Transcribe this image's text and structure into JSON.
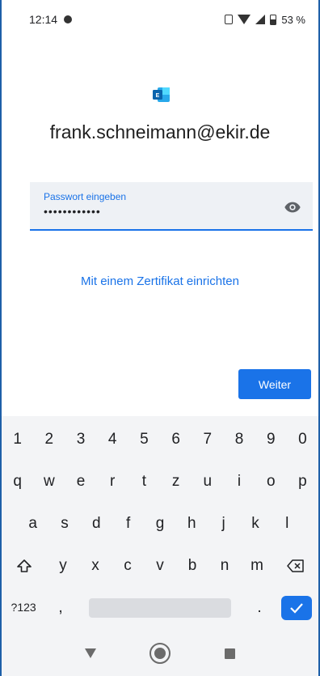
{
  "status_bar": {
    "time": "12:14",
    "battery": "53 %"
  },
  "app": {
    "email": "frank.schneimann@ekir.de",
    "password_label": "Passwort eingeben",
    "password_value": "••••••••••••",
    "certificate_link": "Mit einem Zertifikat einrichten",
    "next_button": "Weiter",
    "accent_color": "#1a73e8",
    "logo_icon": "exchange-logo-icon"
  },
  "keyboard": {
    "row1": [
      "1",
      "2",
      "3",
      "4",
      "5",
      "6",
      "7",
      "8",
      "9",
      "0"
    ],
    "row2": [
      "q",
      "w",
      "e",
      "r",
      "t",
      "z",
      "u",
      "i",
      "o",
      "p"
    ],
    "row3": [
      "a",
      "s",
      "d",
      "f",
      "g",
      "h",
      "j",
      "k",
      "l"
    ],
    "row4": [
      "y",
      "x",
      "c",
      "v",
      "b",
      "n",
      "m"
    ],
    "symbols_key": "?123",
    "comma_key": ",",
    "period_key": "."
  }
}
